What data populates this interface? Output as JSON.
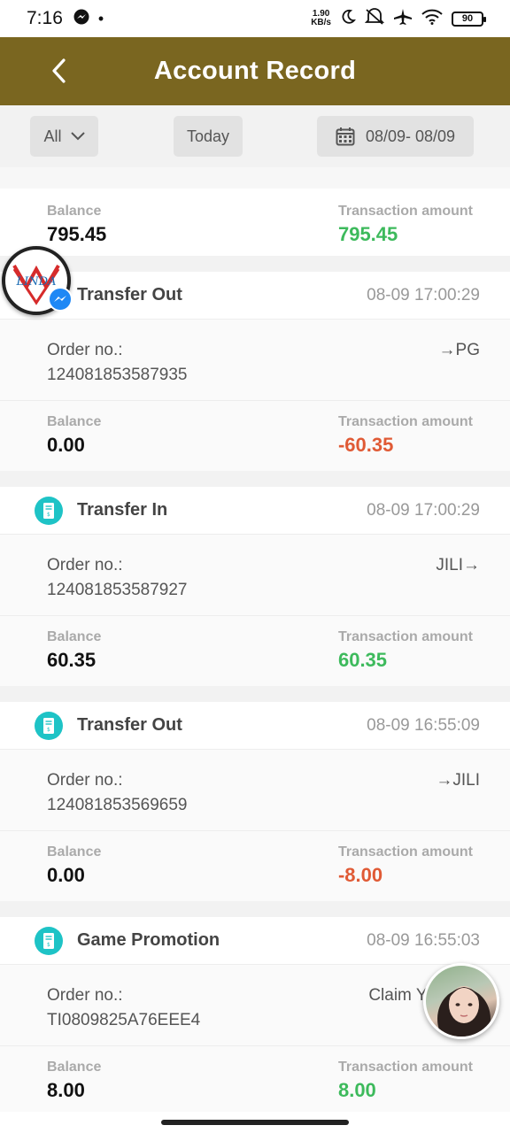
{
  "status_bar": {
    "time": "7:16",
    "net_speed_value": "1.90",
    "net_speed_unit": "KB/s",
    "battery": "90"
  },
  "header": {
    "title": "Account Record"
  },
  "filters": {
    "type_select": "All",
    "today_button": "Today",
    "date_range": "08/09- 08/09"
  },
  "first_card": {
    "balance_label": "Balance",
    "balance": "795.45",
    "amount_label": "Transaction amount",
    "amount": "795.45"
  },
  "records": [
    {
      "type": "Transfer Out",
      "time": "08-09 17:00:29",
      "order_label": "Order no.:",
      "order_no": "124081853587935",
      "direction": "→PG",
      "balance_label": "Balance",
      "balance": "0.00",
      "amount_label": "Transaction amount",
      "amount": "-60.35"
    },
    {
      "type": "Transfer In",
      "time": "08-09 17:00:29",
      "order_label": "Order no.:",
      "order_no": "124081853587927",
      "direction": "JILI→",
      "balance_label": "Balance",
      "balance": "60.35",
      "amount_label": "Transaction amount",
      "amount": "60.35"
    },
    {
      "type": "Transfer Out",
      "time": "08-09 16:55:09",
      "order_label": "Order no.:",
      "order_no": "124081853569659",
      "direction": "→JILI",
      "balance_label": "Balance",
      "balance": "0.00",
      "amount_label": "Transaction amount",
      "amount": "-8.00"
    },
    {
      "type": "Game Promotion",
      "time": "08-09 16:55:03",
      "order_label": "Order no.:",
      "order_no": "TI0809825A76EEE4",
      "direction": "Claim Your Fre",
      "balance_label": "Balance",
      "balance": "8.00",
      "amount_label": "Transaction amount",
      "amount": "8.00"
    }
  ],
  "floating": {
    "linda_text": "LINDA"
  },
  "colors": {
    "header_bg": "#7a6620",
    "positive": "#3dba5c",
    "negative": "#e05a35",
    "icon_teal": "#1ec3c6"
  }
}
